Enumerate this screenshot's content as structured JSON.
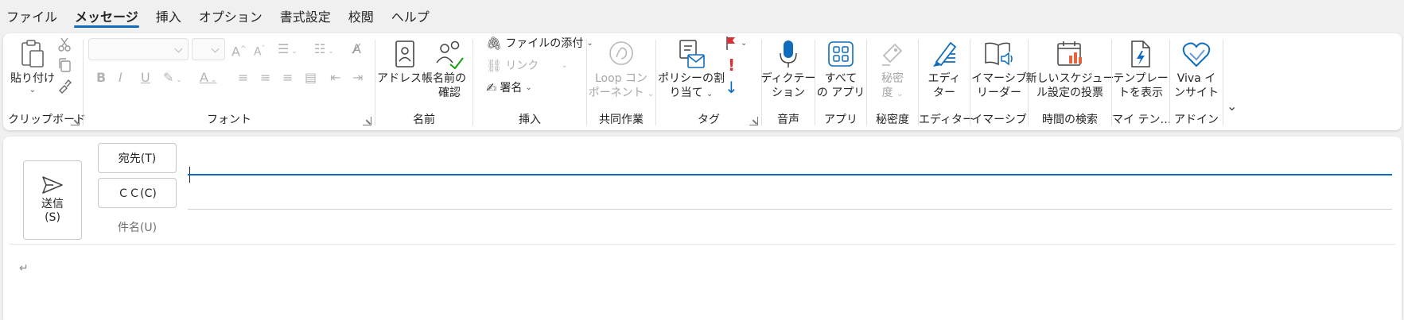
{
  "menu": {
    "items": [
      "ファイル",
      "メッセージ",
      "挿入",
      "オプション",
      "書式設定",
      "校閲",
      "ヘルプ"
    ],
    "active_index": 1
  },
  "ribbon": {
    "clipboard": {
      "paste": "貼り付け",
      "label": "クリップボード"
    },
    "font": {
      "label": "フォント"
    },
    "names": {
      "address_book": "アドレス帳",
      "check_names_1": "名前の",
      "check_names_2": "確認",
      "label": "名前"
    },
    "insert": {
      "attach": "ファイルの添付",
      "link": "リンク",
      "signature": "署名",
      "label": "挿入"
    },
    "collab": {
      "loop_1": "Loop コン",
      "loop_2": "ポーネント",
      "label": "共同作業"
    },
    "tags": {
      "policy_1": "ポリシーの割",
      "policy_2": "り当て",
      "label": "タグ"
    },
    "voice": {
      "dictate_1": "ディクテー",
      "dictate_2": "ション",
      "label": "音声"
    },
    "apps": {
      "all_apps_1": "すべて",
      "all_apps_2": "の アプリ",
      "label": "アプリ"
    },
    "sensitivity": {
      "sens_1": "秘密",
      "sens_2": "度",
      "label": "秘密度"
    },
    "editor": {
      "editor_1": "エディ",
      "editor_2": "ター",
      "label": "エディター"
    },
    "immersive": {
      "reader_1": "イマーシブ",
      "reader_2": "リーダー",
      "label": "イマーシブ"
    },
    "schedule": {
      "poll_1": "新しいスケジュー",
      "poll_2": "ル設定の投票",
      "label": "時間の検索"
    },
    "templates": {
      "view_1": "テンプレー",
      "view_2": "トを表示",
      "label": "マイ テン…"
    },
    "addins": {
      "viva_1": "Viva イ",
      "viva_2": "ンサイト",
      "label": "アドイン"
    }
  },
  "compose": {
    "send_1": "送信",
    "send_2": "(S)",
    "to_label": "宛先(T)",
    "cc_label": "ＣＣ(C)",
    "subject_label": "件名(U)",
    "to_value": "",
    "cc_value": "",
    "subject_value": "",
    "body_mark": "↵"
  },
  "colors": {
    "accent": "#0f6cbd",
    "flag_red": "#d13438",
    "exclaim_red": "#d13438",
    "low_blue": "#0f6cbd"
  }
}
